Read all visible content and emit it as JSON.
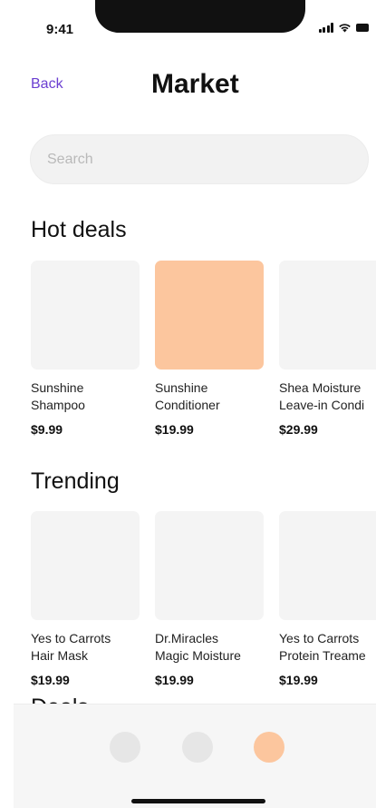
{
  "status_bar": {
    "time": "9:41"
  },
  "header": {
    "back_label": "Back",
    "title": "Market"
  },
  "search": {
    "placeholder": "Search"
  },
  "sections": [
    {
      "title": "Hot deals",
      "products": [
        {
          "name": "Sunshine\nShampoo",
          "price": "$9.99",
          "color": "#f4f4f4"
        },
        {
          "name": "Sunshine\nConditioner",
          "price": "$19.99",
          "color": "#fcc69e"
        },
        {
          "name": "Shea Moisture\nLeave-in Condi",
          "price": "$29.99",
          "color": "#f4f4f4"
        }
      ]
    },
    {
      "title": "Trending",
      "products": [
        {
          "name": "Yes to Carrots\nHair Mask",
          "price": "$19.99",
          "color": "#f4f4f4"
        },
        {
          "name": "Dr.Miracles\nMagic Moisture",
          "price": "$19.99",
          "color": "#f4f4f4"
        },
        {
          "name": "Yes to Carrots\nProtein Treame",
          "price": "$19.99",
          "color": "#f4f4f4"
        }
      ]
    }
  ],
  "partial_section": {
    "title": "Deals"
  },
  "tab_bar": {
    "tabs": [
      {
        "name": "tab-1",
        "color": "#e6e6e6",
        "active": false
      },
      {
        "name": "tab-2",
        "color": "#e6e6e6",
        "active": false
      },
      {
        "name": "tab-3",
        "color": "#fcc69e",
        "active": true
      }
    ]
  },
  "colors": {
    "accent": "#6b3fd1",
    "highlight": "#fcc69e",
    "placeholder_bg": "#f4f4f4"
  }
}
